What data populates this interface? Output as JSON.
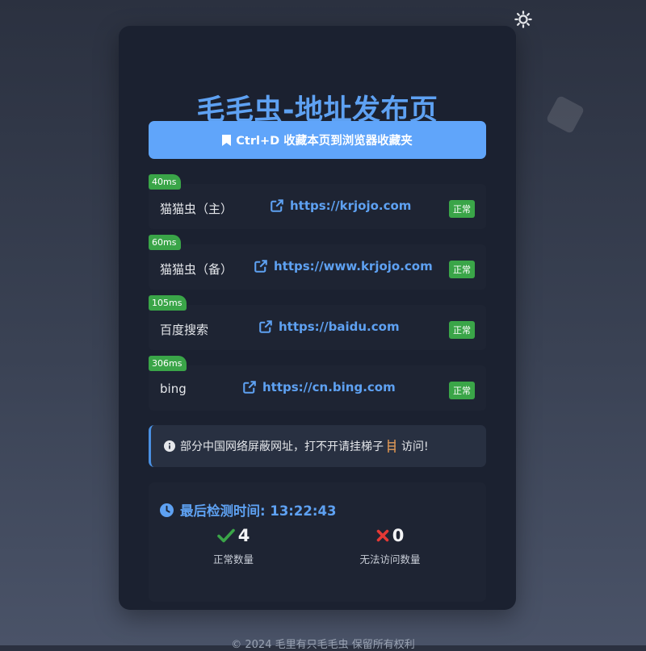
{
  "header": {
    "title": "毛毛虫-地址发布页",
    "theme_icon": "sun-icon"
  },
  "bookmark": {
    "label": "Ctrl+D 收藏本页到浏览器收藏夹",
    "icon": "bookmark-icon"
  },
  "links": [
    {
      "latency": "40ms",
      "name": "猫猫虫（主）",
      "url": "https://krjojo.com",
      "status": "正常"
    },
    {
      "latency": "60ms",
      "name": "猫猫虫（备）",
      "url": "https://www.krjojo.com",
      "status": "正常"
    },
    {
      "latency": "105ms",
      "name": "百度搜索",
      "url": "https://baidu.com",
      "status": "正常"
    },
    {
      "latency": "306ms",
      "name": "bing",
      "url": "https://cn.bing.com",
      "status": "正常"
    }
  ],
  "notice": {
    "text_before": "部分中国网络屏蔽网址，打不开请挂梯子",
    "text_after": "访问!",
    "icon": "info-icon"
  },
  "stats": {
    "check_time": "最后检测时间: 13:22:43",
    "ok_count": "4",
    "ok_label": "正常数量",
    "fail_count": "0",
    "fail_label": "无法访问数量"
  },
  "footer": {
    "text": "© 2024 毛里有只毛毛虫  保留所有权利"
  },
  "colors": {
    "accent": "#5ea1f2",
    "success": "#3aa548",
    "danger": "#e53935",
    "card": "#1b2130"
  }
}
